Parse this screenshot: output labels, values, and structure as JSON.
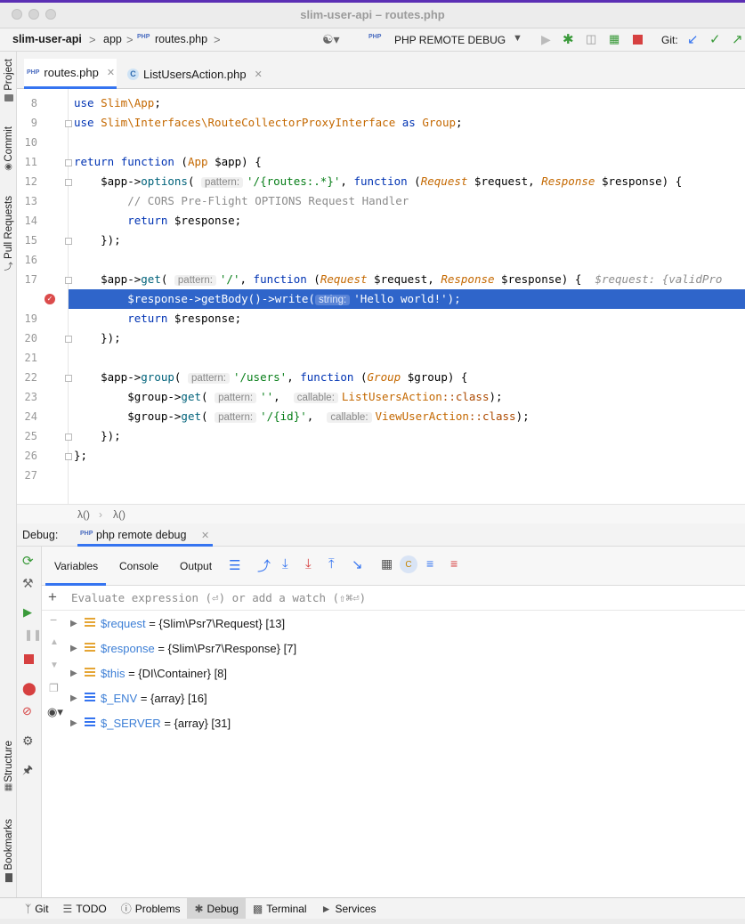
{
  "window": {
    "title": "slim-user-api – routes.php"
  },
  "nav": {
    "project": "slim-user-api",
    "folder": "app",
    "file": "routes.php",
    "run_config": "PHP REMOTE DEBUG",
    "git_label": "Git:"
  },
  "left_strip": {
    "project": "Project",
    "commit": "Commit",
    "pull_requests": "Pull Requests",
    "structure": "Structure",
    "bookmarks": "Bookmarks"
  },
  "tabs": [
    {
      "label": "routes.php",
      "icon": "php-file-icon",
      "active": true
    },
    {
      "label": "ListUsersAction.php",
      "icon": "class-icon",
      "active": false
    }
  ],
  "editor": {
    "line_numbers": [
      "8",
      "9",
      "10",
      "11",
      "12",
      "13",
      "14",
      "15",
      "16",
      "17",
      "18",
      "19",
      "20",
      "21",
      "22",
      "23",
      "24",
      "25",
      "26",
      "27"
    ],
    "hints": {
      "pattern": "pattern:",
      "string": "string:",
      "callable": "callable:"
    },
    "code": {
      "l8_kw": "use",
      "l8_ns": "Slim\\App",
      "l8_end": ";",
      "l9_kw": "use",
      "l9_ns": "Slim\\Interfaces\\RouteCollectorProxyInterface",
      "l9_as": "as",
      "l9_alias": "Group",
      "l9_end": ";",
      "l11_return": "return",
      "l11_function": "function",
      "l11_type": "App",
      "l11_rest": " $app) {",
      "l12_a": "    $app->",
      "l12_fn": "options",
      "l12_str": "'/{routes:.*}'",
      "l12_function": "function",
      "l12_t1": "Request",
      "l12_v1": " $request, ",
      "l12_t2": "Response",
      "l12_v2": " $response) {",
      "l13": "        // CORS Pre-Flight OPTIONS Request Handler",
      "l14_kw": "return",
      "l14_v": " $response;",
      "l15": "    });",
      "l17_a": "    $app->",
      "l17_fn": "get",
      "l17_str": "'/'",
      "l17_function": "function",
      "l17_t1": "Request",
      "l17_v1": " $request, ",
      "l17_t2": "Response",
      "l17_v2": " $response) {",
      "l17_inline": "$request: {validPro",
      "l18_a": "        $response->getBody()->write(",
      "l18_str": "'Hello world!'",
      "l18_end": ");",
      "l19_kw": "return",
      "l19_v": " $response;",
      "l20": "    });",
      "l22_a": "    $app->",
      "l22_fn": "group",
      "l22_str": "'/users'",
      "l22_function": "function",
      "l22_t": "Group",
      "l22_v": " $group) {",
      "l23_a": "        $group->",
      "l23_fn": "get",
      "l23_str": "''",
      "l23_cls": "ListUsersAction",
      "l23_kw": "::class",
      "l23_end": ");",
      "l24_a": "        $group->",
      "l24_fn": "get",
      "l24_str": "'/{id}'",
      "l24_cls": "ViewUserAction",
      "l24_kw": "::class",
      "l24_end": ");",
      "l25": "    });",
      "l26": "};"
    }
  },
  "breadcrumb": {
    "item1": "λ()",
    "item2": "λ()"
  },
  "debug": {
    "label": "Debug:",
    "session": "php remote debug",
    "tabs": [
      "Variables",
      "Console",
      "Output"
    ],
    "watch_placeholder": "Evaluate expression (⏎) or add a watch (⇧⌘⏎)",
    "variables": [
      {
        "name": "$request",
        "value": "= {Slim\\Psr7\\Request} [13]",
        "icon": "object-icon"
      },
      {
        "name": "$response",
        "value": "= {Slim\\Psr7\\Response} [7]",
        "icon": "object-icon"
      },
      {
        "name": "$this",
        "value": "= {DI\\Container} [8]",
        "icon": "object-icon"
      },
      {
        "name": "$_ENV",
        "value": "= {array} [16]",
        "icon": "array-icon"
      },
      {
        "name": "$_SERVER",
        "value": "= {array} [31]",
        "icon": "array-icon"
      }
    ]
  },
  "bottom": {
    "git": "Git",
    "todo": "TODO",
    "problems": "Problems",
    "debug": "Debug",
    "terminal": "Terminal",
    "services": "Services"
  },
  "colors": {
    "selection": "#2f65ca",
    "keyword": "#0033b3",
    "string": "#067d17",
    "class": "#c46800"
  }
}
